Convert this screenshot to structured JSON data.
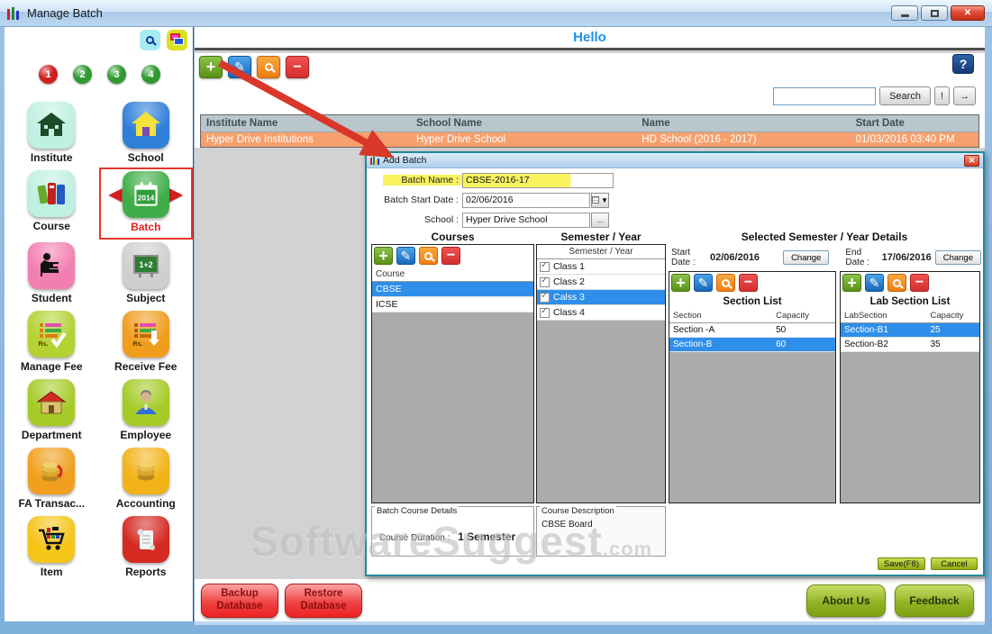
{
  "window": {
    "title": "Manage Batch"
  },
  "sidebar": {
    "steps": [
      "1",
      "2",
      "3",
      "4"
    ],
    "items": [
      {
        "label": "Institute"
      },
      {
        "label": "School"
      },
      {
        "label": "Course"
      },
      {
        "label": "Batch",
        "icon_text": "2014"
      },
      {
        "label": "Student"
      },
      {
        "label": "Subject",
        "icon_text": "1+2"
      },
      {
        "label": "Manage Fee",
        "icon_text": "Rs."
      },
      {
        "label": "Receive Fee",
        "icon_text": "Rs."
      },
      {
        "label": "Department"
      },
      {
        "label": "Employee"
      },
      {
        "label": "FA Transac..."
      },
      {
        "label": "Accounting"
      },
      {
        "label": "Item"
      },
      {
        "label": "Reports"
      }
    ]
  },
  "header": {
    "title": "Hello",
    "help": "?",
    "search_value": "",
    "search_button": "Search",
    "alert_button": "!",
    "go_button": "→"
  },
  "table": {
    "headers": [
      "Institute Name",
      "School Name",
      "Name",
      "Start Date"
    ],
    "row": [
      "Hyper Drive Institutions",
      "Hyper Drive School",
      "HD School (2016 - 2017)",
      "01/03/2016 03:40 PM"
    ]
  },
  "dialog": {
    "title": "Add Batch",
    "fields": {
      "batch_name_label": "Batch Name :",
      "batch_name_value": "CBSE-2016-17",
      "start_date_label": "Batch Start Date :",
      "start_date_value": "02/06/2016",
      "school_label": "School :",
      "school_value": "Hyper Drive School",
      "browse_label": "..."
    },
    "columns": {
      "courses": "Courses",
      "semester": "Semester / Year",
      "selected": "Selected Semester / Year Details"
    },
    "courses": {
      "header": "Course",
      "items": [
        {
          "name": "CBSE"
        },
        {
          "name": "ICSE"
        }
      ]
    },
    "semesters": {
      "header": "Semester / Year",
      "items": [
        {
          "name": "Class 1"
        },
        {
          "name": "Class 2"
        },
        {
          "name": "Calss 3"
        },
        {
          "name": "Class 4"
        }
      ]
    },
    "details": {
      "start_label": "Start Date :",
      "start_value": "02/06/2016",
      "change_label": "Change",
      "end_label": "End Date :",
      "end_value": "17/06/2016",
      "section_list": {
        "title": "Section List",
        "col1": "Section",
        "col2": "Capacity",
        "rows": [
          {
            "name": "Section -A",
            "capacity": "50"
          },
          {
            "name": "Section-B",
            "capacity": "60"
          }
        ]
      },
      "lab_list": {
        "title": "Lab Section List",
        "col1": "LabSection",
        "col2": "Capacity",
        "rows": [
          {
            "name": "Section-B1",
            "capacity": "25"
          },
          {
            "name": "Section-B2",
            "capacity": "35"
          }
        ]
      }
    },
    "course_details": {
      "title": "Batch  Course Details",
      "duration_label": "Course Duration :",
      "duration_value": "1 Semester"
    },
    "course_description": {
      "title": "Course Description",
      "value": "CBSE Board"
    },
    "save_label": "Save(F8)",
    "cancel_label": "Cancel"
  },
  "footer": {
    "backup": "Backup Database",
    "restore": "Restore Database",
    "about": "About Us",
    "feedback": "Feedback"
  },
  "watermark": {
    "text": "SoftwareSuggest",
    "suffix": ".com"
  }
}
